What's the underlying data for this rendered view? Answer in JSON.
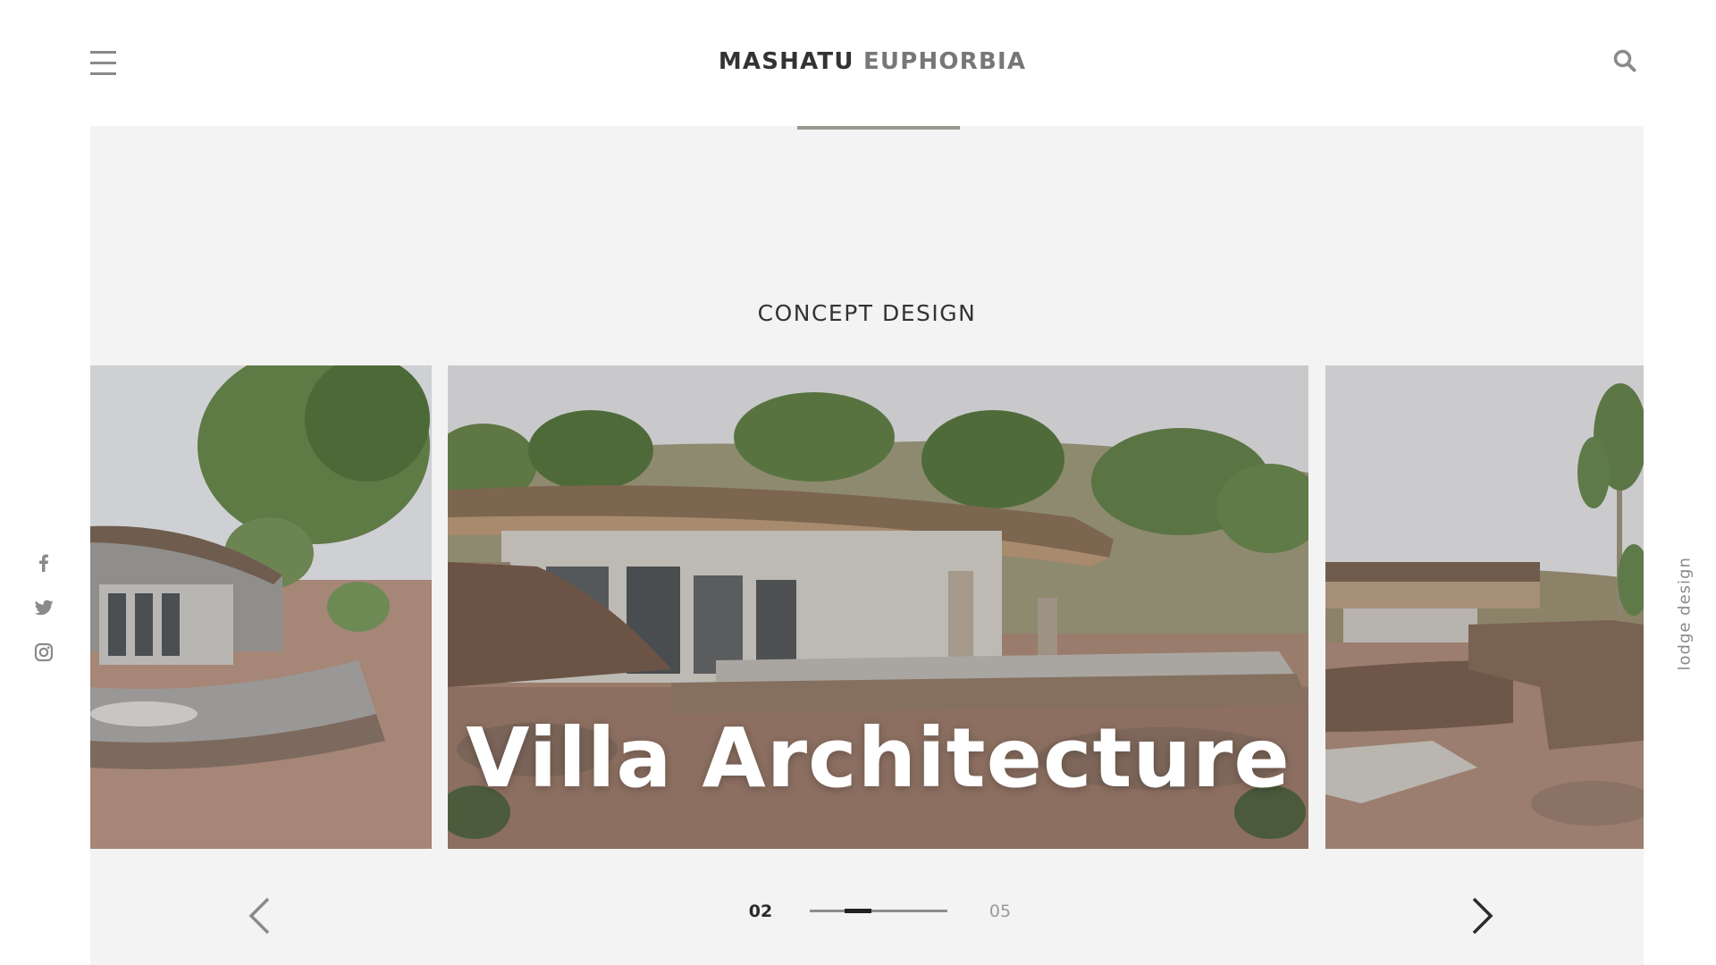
{
  "header": {
    "logo_primary": "MASHATU",
    "logo_secondary": "EUPHORBIA",
    "menu_icon": "hamburger-icon",
    "search_icon": "search-icon"
  },
  "section": {
    "title": "CONCEPT DESIGN"
  },
  "slider": {
    "caption": "Villa Architecture",
    "current": "02",
    "total": "05",
    "progress_fraction": 0.25,
    "prev_icon": "chevron-left-icon",
    "next_icon": "chevron-right-icon"
  },
  "social": [
    {
      "name": "facebook-icon"
    },
    {
      "name": "twitter-icon"
    },
    {
      "name": "instagram-icon"
    }
  ],
  "side_label": "lodge design",
  "colors": {
    "panel_bg": "#f3f3f3",
    "accent_bar": "#a29d95",
    "text_dark": "#2b2b2b",
    "text_muted": "#8a8a8a"
  }
}
